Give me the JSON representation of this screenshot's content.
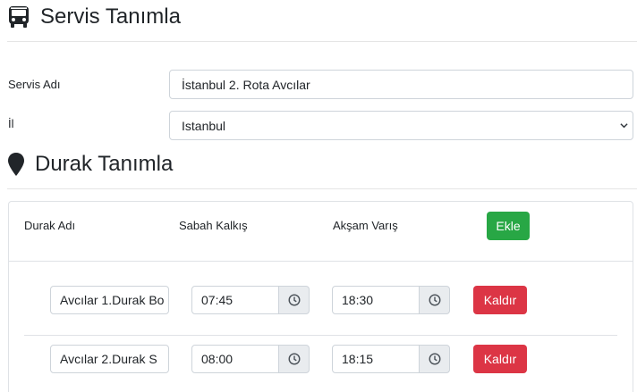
{
  "service_section": {
    "title": "Servis Tanımla",
    "icon": "bus-icon",
    "name_label": "Servis Adı",
    "name_value": "İstanbul 2. Rota Avcılar",
    "city_label": "İl",
    "city_selected": "Istanbul"
  },
  "stop_section": {
    "title": "Durak Tanımla",
    "icon": "map-marker-icon",
    "headers": {
      "name": "Durak Adı",
      "morning": "Sabah Kalkış",
      "evening": "Akşam Varış"
    },
    "add_label": "Ekle",
    "remove_label": "Kaldır",
    "rows": [
      {
        "name": "Avcılar 1.Durak Bo",
        "morning": "07:45",
        "evening": "18:30"
      },
      {
        "name": "Avcılar 2.Durak S",
        "morning": "08:00",
        "evening": "18:15"
      }
    ]
  },
  "colors": {
    "success": "#28a745",
    "danger": "#dc3545",
    "border": "#ced4da",
    "addon_bg": "#e9ecef"
  }
}
